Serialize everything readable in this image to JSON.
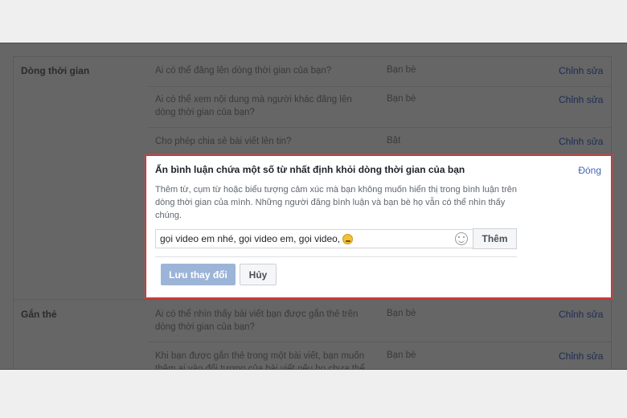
{
  "timeline": {
    "section_title": "Dòng thời gian",
    "rows": [
      {
        "question": "Ai có thể đăng lên dòng thời gian của bạn?",
        "value": "Bạn bè",
        "edit": "Chỉnh sửa"
      },
      {
        "question": "Ai có thể xem nội dung mà người khác đăng lên dòng thời gian của bạn?",
        "value": "Bạn bè",
        "edit": "Chỉnh sửa"
      },
      {
        "question": "Cho phép chia sẻ bài viết lên tin?",
        "value": "Bật",
        "edit": "Chỉnh sửa"
      }
    ]
  },
  "dialog": {
    "title": "Ẩn bình luận chứa một số từ nhất định khỏi dòng thời gian của bạn",
    "close_label": "Đóng",
    "description": "Thêm từ, cụm từ hoặc biểu tượng cảm xúc mà bạn không muốn hiển thị trong bình luận trên dòng thời gian của mình. Những người đăng bình luận và bạn bè họ vẫn có thể nhìn thấy chúng.",
    "keywords_value": "gọi video em nhé, gọi video em, gọi video,",
    "add_label": "Thêm",
    "save_label": "Lưu thay đổi",
    "cancel_label": "Hủy"
  },
  "tagging": {
    "section_title": "Gắn thẻ",
    "rows": [
      {
        "question": "Ai có thể nhìn thấy bài viết bạn được gắn thẻ trên dòng thời gian của bạn?",
        "value": "Bạn bè",
        "edit": "Chỉnh sửa"
      },
      {
        "question": "Khi bạn được gắn thẻ trong một bài viết, bạn muốn thêm ai vào đối tượng của bài viết nếu họ chưa thể",
        "value": "Bạn bè",
        "edit": "Chỉnh sửa"
      }
    ]
  },
  "colors": {
    "link": "#4267b2",
    "dialog_border": "#cc2a2a",
    "save_button": "#9cb4d8"
  }
}
